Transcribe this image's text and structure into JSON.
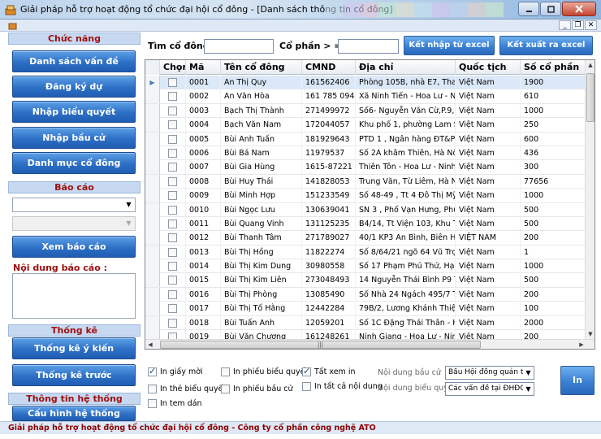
{
  "window": {
    "title": "Giải pháp hỗ trợ hoạt động tổ chức đại hội cổ đông - [Danh sách thông tin cổ đông]"
  },
  "sidebar": {
    "functions_header": "Chức năng",
    "nav": [
      {
        "label": "Danh sách vấn đề"
      },
      {
        "label": "Đăng ký dự"
      },
      {
        "label": "Nhập biểu quyết"
      },
      {
        "label": "Nhập bầu cử"
      },
      {
        "label": "Danh mục cổ đông"
      }
    ],
    "report_header": "Báo cáo",
    "report_select_1": "",
    "report_select_2": "",
    "view_report_button": "Xem báo cáo",
    "report_content_label": "Nội dung báo cáo :",
    "stats_header": "Thống kê",
    "stats_buttons": [
      {
        "label": "Thống kê ý kiến"
      },
      {
        "label": "Thống kê trước"
      }
    ],
    "sysinfo_header": "Thông tin hệ thống",
    "sysconfig_button": "Cấu hình hệ thống"
  },
  "search": {
    "shareholder_label": "Tìm cổ đông",
    "shareholder_value": "",
    "shares_label": "Cổ phần > =",
    "shares_value": "",
    "import_button": "Kết nhập từ excel",
    "export_button": "Kết xuất ra excel"
  },
  "table": {
    "columns": [
      "Chọn",
      "Mã",
      "Tên cổ đông",
      "CMND",
      "Địa chỉ",
      "Quốc tịch",
      "Số cổ phần"
    ],
    "rows": [
      [
        "0001",
        "An Thị Quy",
        "161562406",
        "Phòng 105B, nhà E7, Thanh…",
        "Việt Nam",
        "1900"
      ],
      [
        "0002",
        "An Văn Hòa",
        "161 785 094",
        "Xã Ninh Tiến - Hoa Lư - Ninh…",
        "Việt Nam",
        "610"
      ],
      [
        "0003",
        "Bạch Thị Thành",
        "271499972",
        "Số6- Nguyễn Văn Cừ,P.9, T…",
        "Việt Nam",
        "1000"
      ],
      [
        "0004",
        "Bạch Văn Nam",
        "172044057",
        "Khu phố 1, phường Lam Sơ…",
        "Việt Nam",
        "250"
      ],
      [
        "0005",
        "Bùi Anh Tuấn",
        "181929643",
        "PTD 1 , Ngân hàng ĐT&PT …",
        "Việt Nam",
        "600"
      ],
      [
        "0006",
        "Bùi Bá Nam",
        "11979537",
        "Số 2A khâm Thiên, Hà Nội",
        "Việt Nam",
        "436"
      ],
      [
        "0007",
        "Bùi Gia Hùng",
        "1615-87221",
        "Thiên Tôn - Hoa Lư - Ninh Bình",
        "Việt Nam",
        "300"
      ],
      [
        "0008",
        "Bùi Huy Thái",
        "141828053",
        "Trung Văn, Từ Liêm, Hà Nội",
        "Việt Nam",
        "77656"
      ],
      [
        "0009",
        "Bùi Minh Hợp",
        "151233549",
        "Số 48-49 , Tt 4 Đô Thị Mỹ Đ…",
        "Việt Nam",
        "1000"
      ],
      [
        "0010",
        "Bùi Ngọc Lưu",
        "130639041",
        "SN 3 , Phố Vạn Hưng, Phườ…",
        "Việt Nam",
        "500"
      ],
      [
        "0011",
        "Bùi Quang Vinh",
        "131125235",
        "B4/14, Tt Viện 103, Khu Tầ…",
        "Việt Nam",
        "500"
      ],
      [
        "0012",
        "Bùi Thanh Tâm",
        "271789027",
        "40/1 KP3 An Bình, Biên Hoà …",
        "VIỆT NAM",
        "200"
      ],
      [
        "0013",
        "Bùi Thị Hồng",
        "11822274",
        "Số 8/64/21 ngõ 64 Vũ Trọn…",
        "Việt Nam",
        "1"
      ],
      [
        "0014",
        "Bùi Thị Kim Dung",
        "30980558",
        "Số 17 Phạm Phú Thứ, Hạ Lý…",
        "Việt Nam",
        "1000"
      ],
      [
        "0015",
        "Bùi Thị Kim Liên",
        "273048493",
        "14 Nguyễn Thái Bình P9 Tp…",
        "Việt Nam",
        "500"
      ],
      [
        "0016",
        "Bùi Thị Phòng",
        "13085490",
        "Số Nhà 24 Ngách 495/7 Tổ …",
        "Việt Nam",
        "200"
      ],
      [
        "0017",
        "Bùi Thị Tố Hằng",
        "12442284",
        "79B/2, Lương Khánh Thiện, …",
        "Việt Nam",
        "100"
      ],
      [
        "0018",
        "Bùi Tuấn Anh",
        "12059201",
        "Số 1C Đặng Thái Thân - Ho…",
        "Việt Nam",
        "2000"
      ],
      [
        "0019",
        "Bùi Văn Chương",
        "161248261",
        "Ninh Giang - Hoa Lư - Ninh …",
        "Việt Nam",
        "200"
      ]
    ]
  },
  "options": {
    "print_invitation": "In giấy mời",
    "print_vote_ballot": "In phiếu biểu quyết",
    "view_all": "Tất xem in",
    "print_vote_card": "In thẻ biểu quyết",
    "print_election_ballot": "In phiếu bầu cử",
    "print_all_content": "In tất cả nội dung",
    "print_label": "In tem dán",
    "election_content_label": "Nội dung bầu cử",
    "election_content_value": "Bầu Hội đồng quản trị nh",
    "vote_content_label": "Nội dung biểu quyết",
    "vote_content_value": "Các vấn đề tại ĐHĐCĐ",
    "print_button": "In"
  },
  "status": {
    "text": "Giải pháp hỗ trợ hoạt động tổ chức đại hội cổ đông - Công ty cổ phần công nghệ ATO"
  },
  "colors": {
    "accent_button": "#2d70c5",
    "section_header_text": "#a01010",
    "status_text": "#8b0000"
  }
}
